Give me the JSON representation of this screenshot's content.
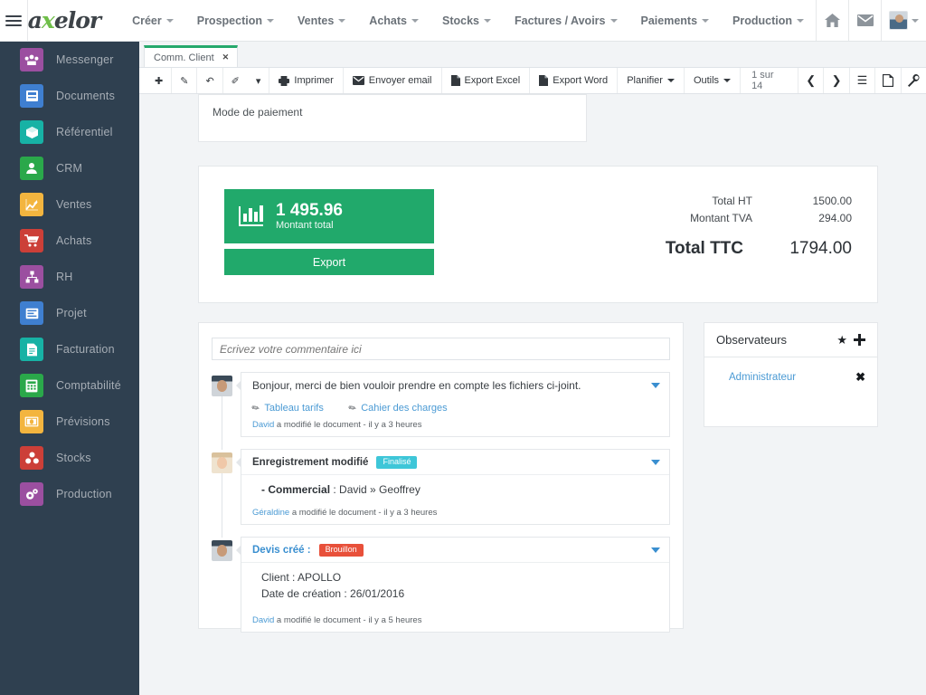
{
  "app": {
    "brand_pre": "a",
    "brand_x": "x",
    "brand_post": "elor",
    "hamburger_name": "menu-toggle"
  },
  "topnav": {
    "items": [
      {
        "label": "Créer",
        "caret": true
      },
      {
        "label": "Prospection",
        "caret": true
      },
      {
        "label": "Ventes",
        "caret": true
      },
      {
        "label": "Achats",
        "caret": true
      },
      {
        "label": "Stocks",
        "caret": true
      },
      {
        "label": "Factures / Avoirs",
        "caret": true
      },
      {
        "label": "Paiements",
        "caret": true
      },
      {
        "label": "Production",
        "caret": true
      }
    ],
    "icons": [
      {
        "name": "home-icon",
        "glyph": "⌂"
      },
      {
        "name": "mail-icon",
        "glyph": "✉"
      },
      {
        "name": "user-avatar",
        "glyph": ""
      }
    ]
  },
  "sidebar": {
    "items": [
      {
        "label": "Messenger",
        "icon": "messenger-icon",
        "color": "#9b4fa0"
      },
      {
        "label": "Documents",
        "icon": "documents-icon",
        "color": "#3f7fd0"
      },
      {
        "label": "Référentiel",
        "icon": "referentiel-icon",
        "color": "#17b2a5"
      },
      {
        "label": "CRM",
        "icon": "crm-icon",
        "color": "#2aa84a"
      },
      {
        "label": "Ventes",
        "icon": "ventes-icon",
        "color": "#f3b53f"
      },
      {
        "label": "Achats",
        "icon": "achats-icon",
        "color": "#cc3f38"
      },
      {
        "label": "RH",
        "icon": "rh-icon",
        "color": "#9b4fa0"
      },
      {
        "label": "Projet",
        "icon": "projet-icon",
        "color": "#3f7fd0"
      },
      {
        "label": "Facturation",
        "icon": "facturation-icon",
        "color": "#17b2a5"
      },
      {
        "label": "Comptabilité",
        "icon": "comptabilite-icon",
        "color": "#2aa84a"
      },
      {
        "label": "Prévisions",
        "icon": "previsions-icon",
        "color": "#f3b53f"
      },
      {
        "label": "Stocks",
        "icon": "stocks-icon",
        "color": "#cc3f38"
      },
      {
        "label": "Production",
        "icon": "production-icon",
        "color": "#9b4fa0"
      }
    ]
  },
  "tab": {
    "label": "Comm. Client",
    "close": "✕"
  },
  "toolbar": {
    "icon_buttons": [
      {
        "name": "new-record-button",
        "glyph": "✚"
      },
      {
        "name": "edit-record-button",
        "glyph": "✎"
      },
      {
        "name": "undo-button",
        "glyph": "↶"
      },
      {
        "name": "attach-button",
        "glyph": "✐"
      },
      {
        "name": "more-actions-button",
        "glyph": "▾"
      }
    ],
    "buttons": [
      {
        "name": "print-button",
        "label": "Imprimer",
        "icon": "printer-icon"
      },
      {
        "name": "send-email-button",
        "label": "Envoyer email",
        "icon": "envelope-icon"
      },
      {
        "name": "export-excel-button",
        "label": "Export Excel",
        "icon": "file-icon"
      },
      {
        "name": "export-word-button",
        "label": "Export Word",
        "icon": "file-icon"
      }
    ],
    "dropdowns": [
      {
        "name": "planifier-dropdown",
        "label": "Planifier"
      },
      {
        "name": "outils-dropdown",
        "label": "Outils"
      }
    ],
    "pager": "1 sur 14",
    "nav": [
      {
        "name": "prev-record-button",
        "glyph": "❮"
      },
      {
        "name": "next-record-button",
        "glyph": "❯"
      },
      {
        "name": "list-view-button",
        "glyph": "☰"
      },
      {
        "name": "form-view-button",
        "glyph": "Ὄ4"
      },
      {
        "name": "settings-button",
        "glyph": "⚒"
      }
    ]
  },
  "form": {
    "payment_mode_label": "Mode de paiement"
  },
  "kpi": {
    "value": "1 495.96",
    "caption": "Montant total",
    "export_label": "Export",
    "color": "#21a96b"
  },
  "totals": {
    "rows": [
      {
        "label": "Total HT",
        "value": "1500.00"
      },
      {
        "label": "Montant TVA",
        "value": "294.00"
      }
    ],
    "grand_label": "Total TTC",
    "grand_value": "1794.00"
  },
  "comments": {
    "placeholder": "Ecrivez votre commentaire ici",
    "items": [
      {
        "avatar": "male",
        "title": "",
        "text": "Bonjour, merci de bien vouloir prendre en compte les fichiers ci-joint.",
        "attachments": [
          {
            "label": "Tableau tarifs"
          },
          {
            "label": "Cahier des charges"
          }
        ],
        "author": "David",
        "meta": " a modifié le document - il y a 3 heures"
      },
      {
        "avatar": "female",
        "title": "Enregistrement modifié",
        "badge": "Finalisé",
        "badge_type": "finalise",
        "body_label": "- Commercial",
        "body_value": " : David » Geoffrey",
        "author": "Géraldine",
        "meta": " a modifié le document - il y a 3 heures"
      },
      {
        "avatar": "male",
        "title": "Devis créé :",
        "badge": "Brouillon",
        "badge_type": "brouillon",
        "line1": "Client : APOLLO",
        "line2": "Date de création : 26/01/2016",
        "author": "David",
        "meta": " a modifié le document - il y a 5 heures"
      }
    ]
  },
  "observers": {
    "title": "Observateurs",
    "star": "★",
    "plus": "➕",
    "name": "Administrateur",
    "remove": "✖"
  }
}
